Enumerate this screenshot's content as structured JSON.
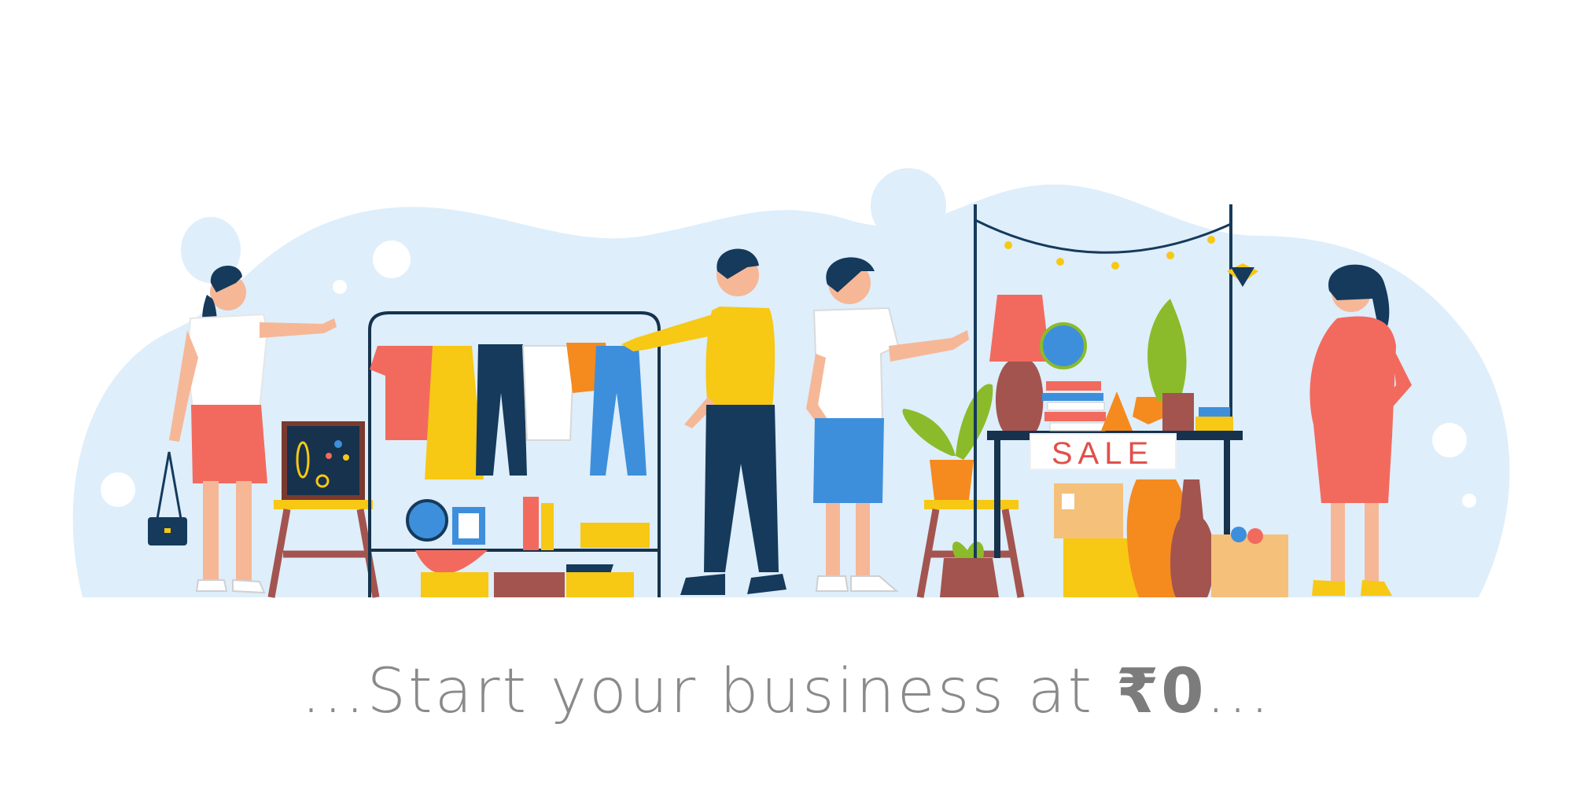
{
  "sign": {
    "text": "SALE"
  },
  "tagline": {
    "prefix": "...Start your business at ",
    "price": "₹0",
    "suffix": "..."
  },
  "colors": {
    "blob": "#deeefb",
    "navy": "#153a5b",
    "yellow": "#f7c814",
    "coral": "#f26a5e",
    "blue": "#3d8fdc",
    "orange": "#f58a1f",
    "skin": "#f6b797",
    "green": "#8bbb2a",
    "brown": "#a3544f",
    "text": "#8a8a8a"
  },
  "icons": [
    "person-icon",
    "clothes-rack-icon",
    "lamp-icon",
    "globe-icon",
    "plant-icon",
    "vase-icon",
    "string-lights-icon"
  ]
}
